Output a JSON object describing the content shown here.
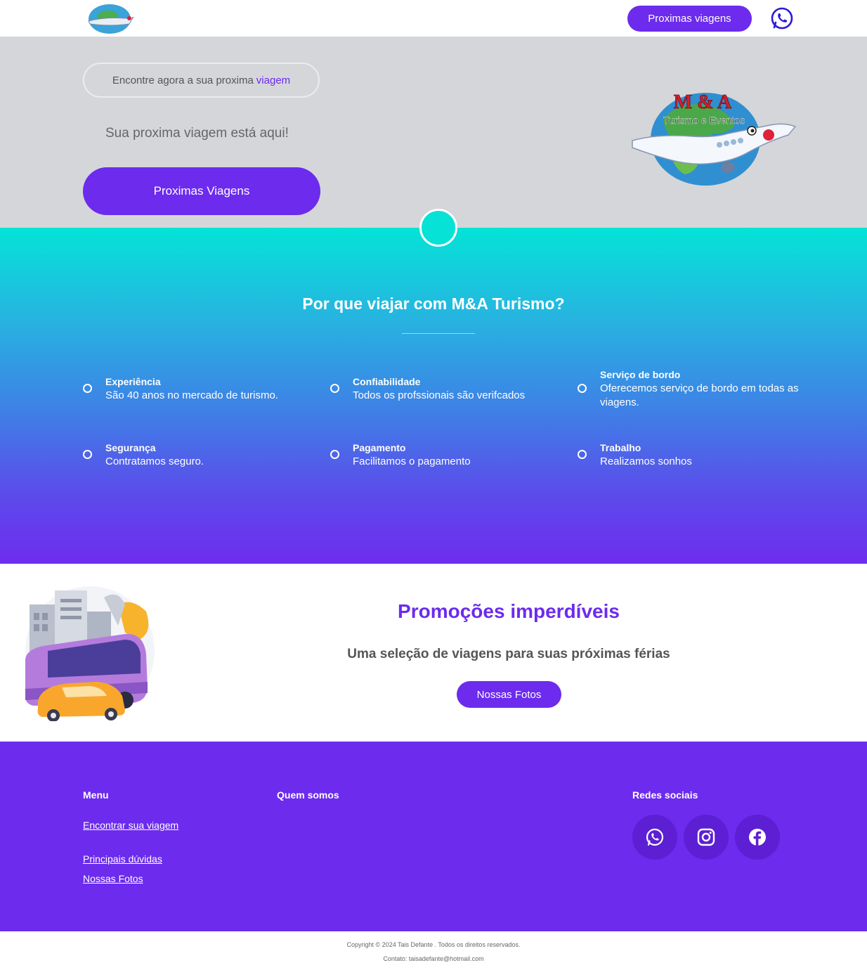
{
  "header": {
    "cta_label": "Proximas viagens",
    "logo_icon": "travel-logo-icon",
    "whatsapp_icon": "whatsapp-icon"
  },
  "hero": {
    "pill_text": "Encontre agora a sua proxima",
    "pill_accent": "viagem",
    "subtitle": "Sua proxima viagem está aqui!",
    "cta_label": "Proximas Viagens",
    "logo_text_top": "M & A",
    "logo_text_bottom": "Turismo e Eventos"
  },
  "features": {
    "title": "Por que viajar com M&A Turismo?",
    "items": [
      {
        "title": "Experiência",
        "desc": "São 40 anos no mercado de turismo."
      },
      {
        "title": "Confiabilidade",
        "desc": "Todos os profssionais são verifcados"
      },
      {
        "title": "Serviço de bordo",
        "desc": "Oferecemos serviço de bordo em todas as viagens."
      },
      {
        "title": "Segurança",
        "desc": "Contratamos seguro."
      },
      {
        "title": "Pagamento",
        "desc": "Facilitamos o pagamento"
      },
      {
        "title": "Trabalho",
        "desc": "Realizamos sonhos"
      }
    ]
  },
  "promo": {
    "title": "Promoções imperdíveis",
    "subtitle": "Uma seleção de viagens para suas próximas férias",
    "cta_label": "Nossas Fotos"
  },
  "footer": {
    "menu_heading": "Menu",
    "about_heading": "Quem somos",
    "social_heading": "Redes sociais",
    "links": [
      "Encontrar sua viagem",
      "Principais dúvidas",
      "Nossas Fotos"
    ],
    "social_icons": [
      "whatsapp-icon",
      "instagram-icon",
      "facebook-icon"
    ]
  },
  "bottom": {
    "copyright": "Copyright © 2024 Tais Defante . Todos os direitos reservados.",
    "contact": "Contato: taisadefante@hotmail.com"
  },
  "colors": {
    "brand": "#6c2bed",
    "teal": "#04e3d7",
    "hero_bg": "#d5d6da"
  }
}
